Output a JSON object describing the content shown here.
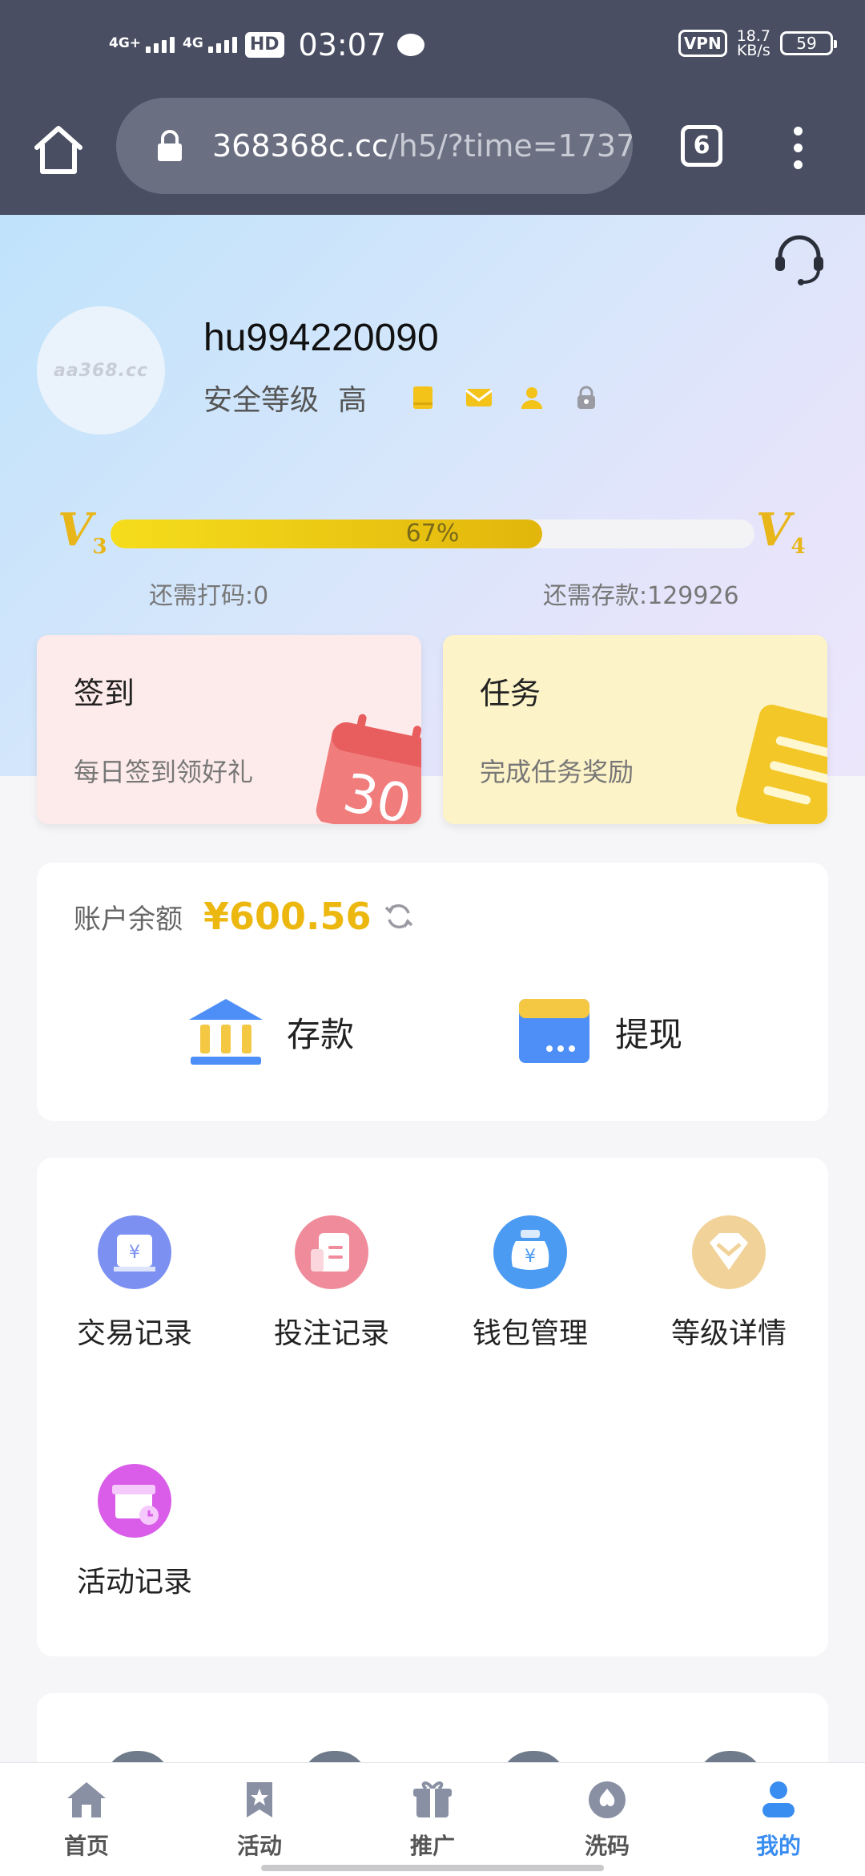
{
  "status_bar": {
    "signal1_label": "4G+",
    "signal2_label": "4G",
    "hd_label": "HD",
    "time": "03:07",
    "vpn_label": "VPN",
    "speed_value": "18.7",
    "speed_unit": "KB/s",
    "battery": "59"
  },
  "browser": {
    "url_host": "368368c.cc",
    "url_path": "/h5/?time=1737",
    "tab_count": "6"
  },
  "profile": {
    "avatar_text": "aa368.cc",
    "username": "hu994220090",
    "security_label": "安全等级",
    "security_value": "高",
    "level_current": "V",
    "level_current_num": "3",
    "level_next": "V",
    "level_next_num": "4",
    "progress": 0.67,
    "progress_label": "67%",
    "need_bet": "还需打码:0",
    "need_deposit": "还需存款:129926"
  },
  "cards": {
    "sign_title": "签到",
    "sign_sub": "每日签到领好礼",
    "task_title": "任务",
    "task_sub": "完成任务奖励"
  },
  "balance": {
    "label": "账户余额",
    "amount": "¥600.56",
    "deposit_label": "存款",
    "withdraw_label": "提现"
  },
  "menu": {
    "items": [
      {
        "label": "交易记录",
        "icon": "transaction-icon"
      },
      {
        "label": "投注记录",
        "icon": "bet-record-icon"
      },
      {
        "label": "钱包管理",
        "icon": "wallet-icon"
      },
      {
        "label": "等级详情",
        "icon": "vip-level-icon"
      },
      {
        "label": "活动记录",
        "icon": "activity-record-icon"
      }
    ]
  },
  "nav": {
    "items": [
      {
        "label": "首页",
        "icon": "home-icon"
      },
      {
        "label": "活动",
        "icon": "activity-icon"
      },
      {
        "label": "推广",
        "icon": "promotion-icon"
      },
      {
        "label": "洗码",
        "icon": "rebate-icon"
      },
      {
        "label": "我的",
        "icon": "profile-icon"
      }
    ],
    "active_index": 4
  },
  "colors": {
    "accent": "#ecb70f",
    "nav_active": "#3a8df0",
    "topbar": "#4a4e62"
  }
}
